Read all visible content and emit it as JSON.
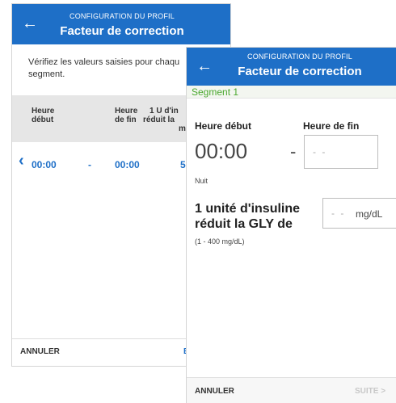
{
  "back_screen": {
    "header": {
      "subtitle": "CONFIGURATION DU PROFIL",
      "title": "Facteur de correction",
      "back_glyph": "←"
    },
    "intro_line1": "Vérifiez les valeurs saisies pour chaqu",
    "intro_line2": "segment.",
    "columns": {
      "start_1": "Heure",
      "start_2": "début",
      "end_1": "Heure",
      "end_2": "de fin",
      "factor_1": "1 U d'in",
      "factor_2": "réduit la",
      "factor_3": "mg"
    },
    "row": {
      "chevron": "‹",
      "start": "00:00",
      "dash": "-",
      "end": "00:00",
      "value": "5"
    },
    "footer": {
      "cancel": "ANNULER",
      "next_partial": "E"
    }
  },
  "front_screen": {
    "header": {
      "subtitle": "CONFIGURATION DU PROFIL",
      "title": "Facteur de correction",
      "back_glyph": "←"
    },
    "segment_title": "Segment 1",
    "start_label": "Heure début",
    "end_label": "Heure de fin",
    "start_value": "00:00",
    "dash": "-",
    "end_placeholder": "- -",
    "period_label": "Nuit",
    "insulin_line1": "1 unité d'insuline",
    "insulin_line2": "réduit la GLY de",
    "value_placeholder": "- -",
    "unit": "mg/dL",
    "range_hint": "(1 - 400 mg/dL)",
    "footer": {
      "cancel": "ANNULER",
      "next": "SUITE >"
    }
  },
  "colors": {
    "header": "#1e6fc7",
    "segment_green": "#4aa82e",
    "link_blue": "#1e6fc7"
  }
}
